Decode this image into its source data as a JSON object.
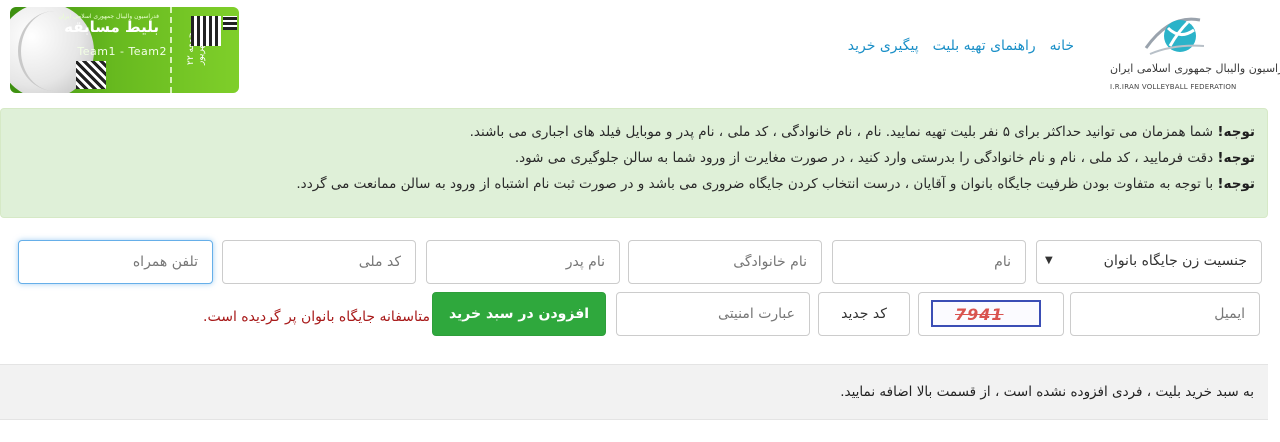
{
  "header": {
    "federation_name": "فدراسیون والیبال جمهوری اسلامی ایران",
    "federation_name_en": "I.R.IRAN VOLLEYBALL FEDERATION",
    "nav": [
      "خانه",
      "راهنمای تهیه بلیت",
      "پیگیری خرید"
    ],
    "ticket": {
      "title": "بلیط مسابقه",
      "subtitle": "فدراسیون والیبال جمهوری اسلامی ایران",
      "teams": "Team1 - Team2",
      "date": "جمعه ۲۲ شهریور"
    }
  },
  "alerts": [
    {
      "label": "توجه!",
      "text": " شما همزمان می توانید حداکثر برای ۵ نفر بلیت تهیه نمایید. نام ، نام خانوادگی ، کد ملی ، نام پدر و موبایل فیلد های اجباری می باشند."
    },
    {
      "label": "توجه!",
      "text": " دقت فرمایید ، کد ملی ، نام و نام خانوادگی را بدرستی وارد کنید ، در صورت مغایرت از ورود شما به سالن جلوگیری می شود."
    },
    {
      "label": "توجه!",
      "text": " با توجه به متفاوت بودن ظرفیت جایگاه بانوان و آقایان ، درست انتخاب کردن جایگاه ضروری می باشد و در صورت ثبت نام اشتباه از ورود به سالن ممانعت می گردد."
    }
  ],
  "form": {
    "gender_select": "جنسیت زن جایگاه بانوان",
    "first_name_placeholder": "نام",
    "last_name_placeholder": "نام خانوادگی",
    "father_name_placeholder": "نام پدر",
    "national_code_placeholder": "کد ملی",
    "mobile_placeholder": "تلفن همراه",
    "email_placeholder": "ایمیل",
    "captcha_text": "7941",
    "new_code_label": "کد جدید",
    "security_placeholder": "عبارت امنیتی",
    "add_button": "افزودن در سبد خرید",
    "error_message": "متاسفانه جایگاه بانوان پر گردیده است."
  },
  "cart": {
    "empty_message": "به سبد خرید بلیت ، فردی افزوده نشده است ، از قسمت بالا اضافه نمایید."
  },
  "colors": {
    "alert_bg": "#dff0d8",
    "link": "#1a8fc7",
    "button_green": "#2fa83d",
    "error": "#a81a1a"
  }
}
